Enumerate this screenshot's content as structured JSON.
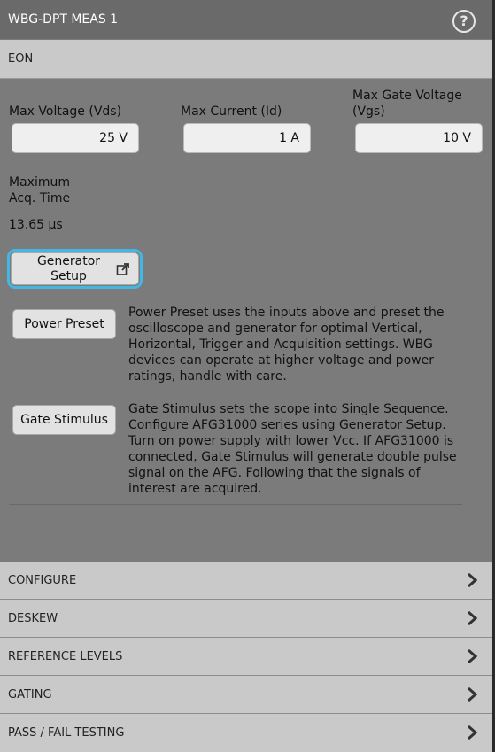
{
  "window": {
    "title": "WBG-DPT MEAS 1",
    "help_glyph": "?"
  },
  "section": {
    "title": "EON"
  },
  "fields": {
    "max_voltage": {
      "label": "Max Voltage (Vds)",
      "value": "25 V"
    },
    "max_current": {
      "label": "Max Current (Id)",
      "value": "1 A"
    },
    "max_gate_voltage": {
      "label_line1": "Max Gate Voltage",
      "label_line2": "(Vgs)",
      "value": "10 V"
    }
  },
  "acq": {
    "label_line1": "Maximum",
    "label_line2": "Acq. Time",
    "value": "13.65 µs"
  },
  "buttons": {
    "generator_setup": {
      "line1": "Generator",
      "line2": "Setup"
    },
    "power_preset": "Power Preset",
    "gate_stimulus": "Gate Stimulus"
  },
  "descriptions": {
    "power_preset": "Power Preset uses the inputs above and preset the oscilloscope and generator for optimal Vertical, Horizontal, Trigger and Acquisition settings. WBG devices can operate at higher voltage and power ratings, handle with care.",
    "gate_stimulus": "Gate Stimulus sets the scope into Single Sequence. Configure AFG31000 series using Generator Setup. Turn on power supply with lower Vcc. If AFG31000 is connected, Gate Stimulus will generate double pulse signal on the AFG. Following that the signals of interest are acquired."
  },
  "nav": [
    "CONFIGURE",
    "DESKEW",
    "REFERENCE LEVELS",
    "GATING",
    "PASS / FAIL TESTING"
  ],
  "colors": {
    "focus_ring": "#43b6e3",
    "panel": "#7b7b7b",
    "header": "#c9c9c9"
  }
}
